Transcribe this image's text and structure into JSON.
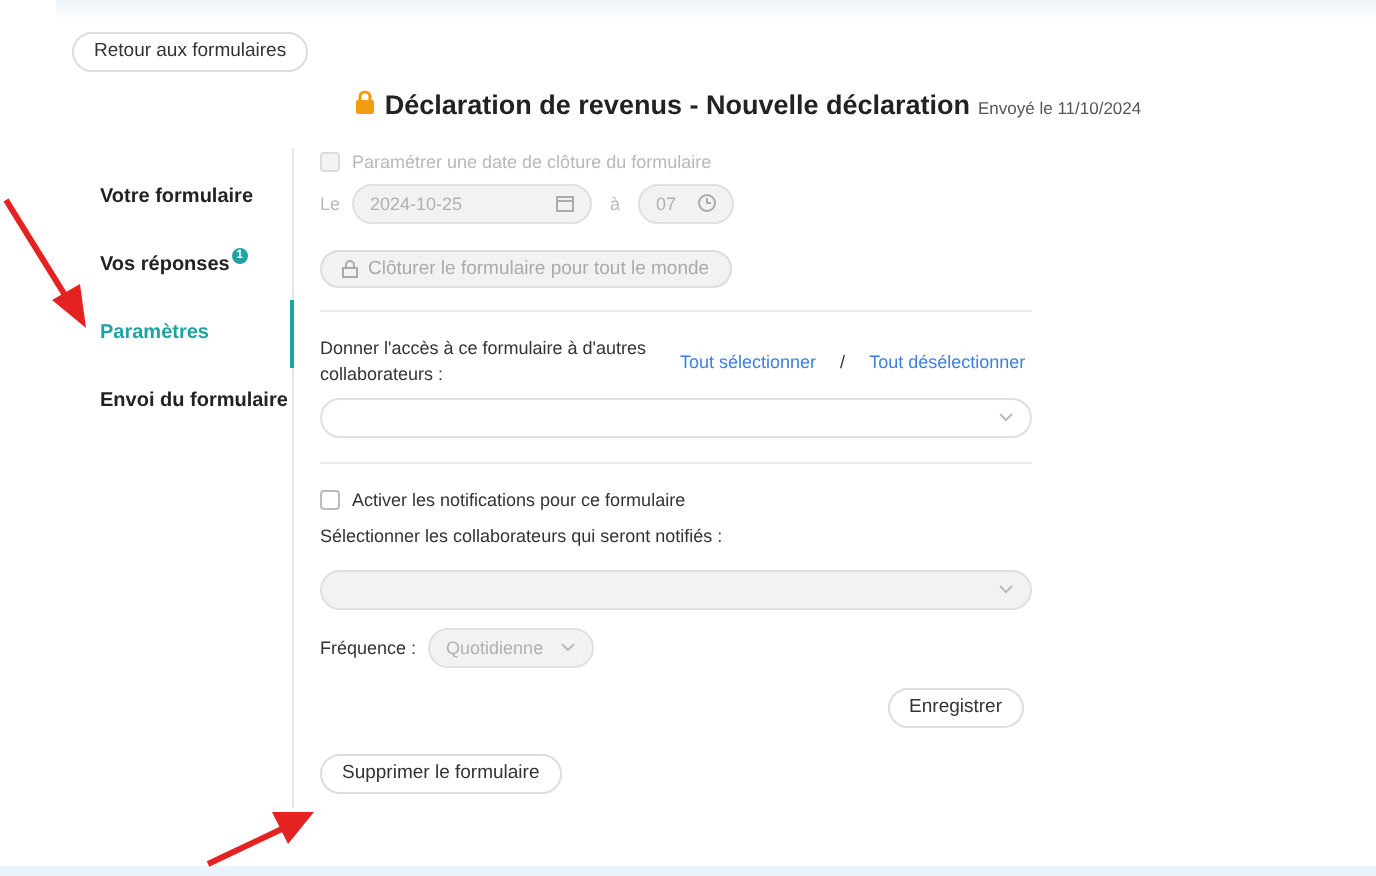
{
  "back_button": "Retour aux formulaires",
  "header": {
    "title": "Déclaration de revenus - Nouvelle déclaration",
    "sent": "Envoyé le 11/10/2024"
  },
  "sidebar": {
    "items": [
      {
        "label": "Votre formulaire",
        "selected": false
      },
      {
        "label": "Vos réponses",
        "selected": false,
        "badge": "1"
      },
      {
        "label": "Paramètres",
        "selected": true
      },
      {
        "label": "Envoi du formulaire",
        "selected": false
      }
    ]
  },
  "closing": {
    "disabled": true,
    "checked": false,
    "checkbox_label": "Paramétrer une date de clôture du formulaire",
    "date_label": "Le",
    "date": "2024-10-25",
    "time_label": "à",
    "hour": "07",
    "close_button": "Clôturer le formulaire pour tout le monde"
  },
  "access": {
    "label": "Donner l'accès à ce formulaire à d'autres collaborateurs :",
    "select_all": "Tout sélectionner",
    "separator": "/",
    "deselect_all": "Tout désélectionner"
  },
  "notifications": {
    "checked": false,
    "checkbox_label": "Activer les notifications pour ce formulaire",
    "select_label": "Sélectionner les collaborateurs qui seront notifiés :",
    "frequency_label": "Fréquence :",
    "frequency": "Quotidienne"
  },
  "save_button": "Enregistrer",
  "delete_button": "Supprimer le formulaire"
}
